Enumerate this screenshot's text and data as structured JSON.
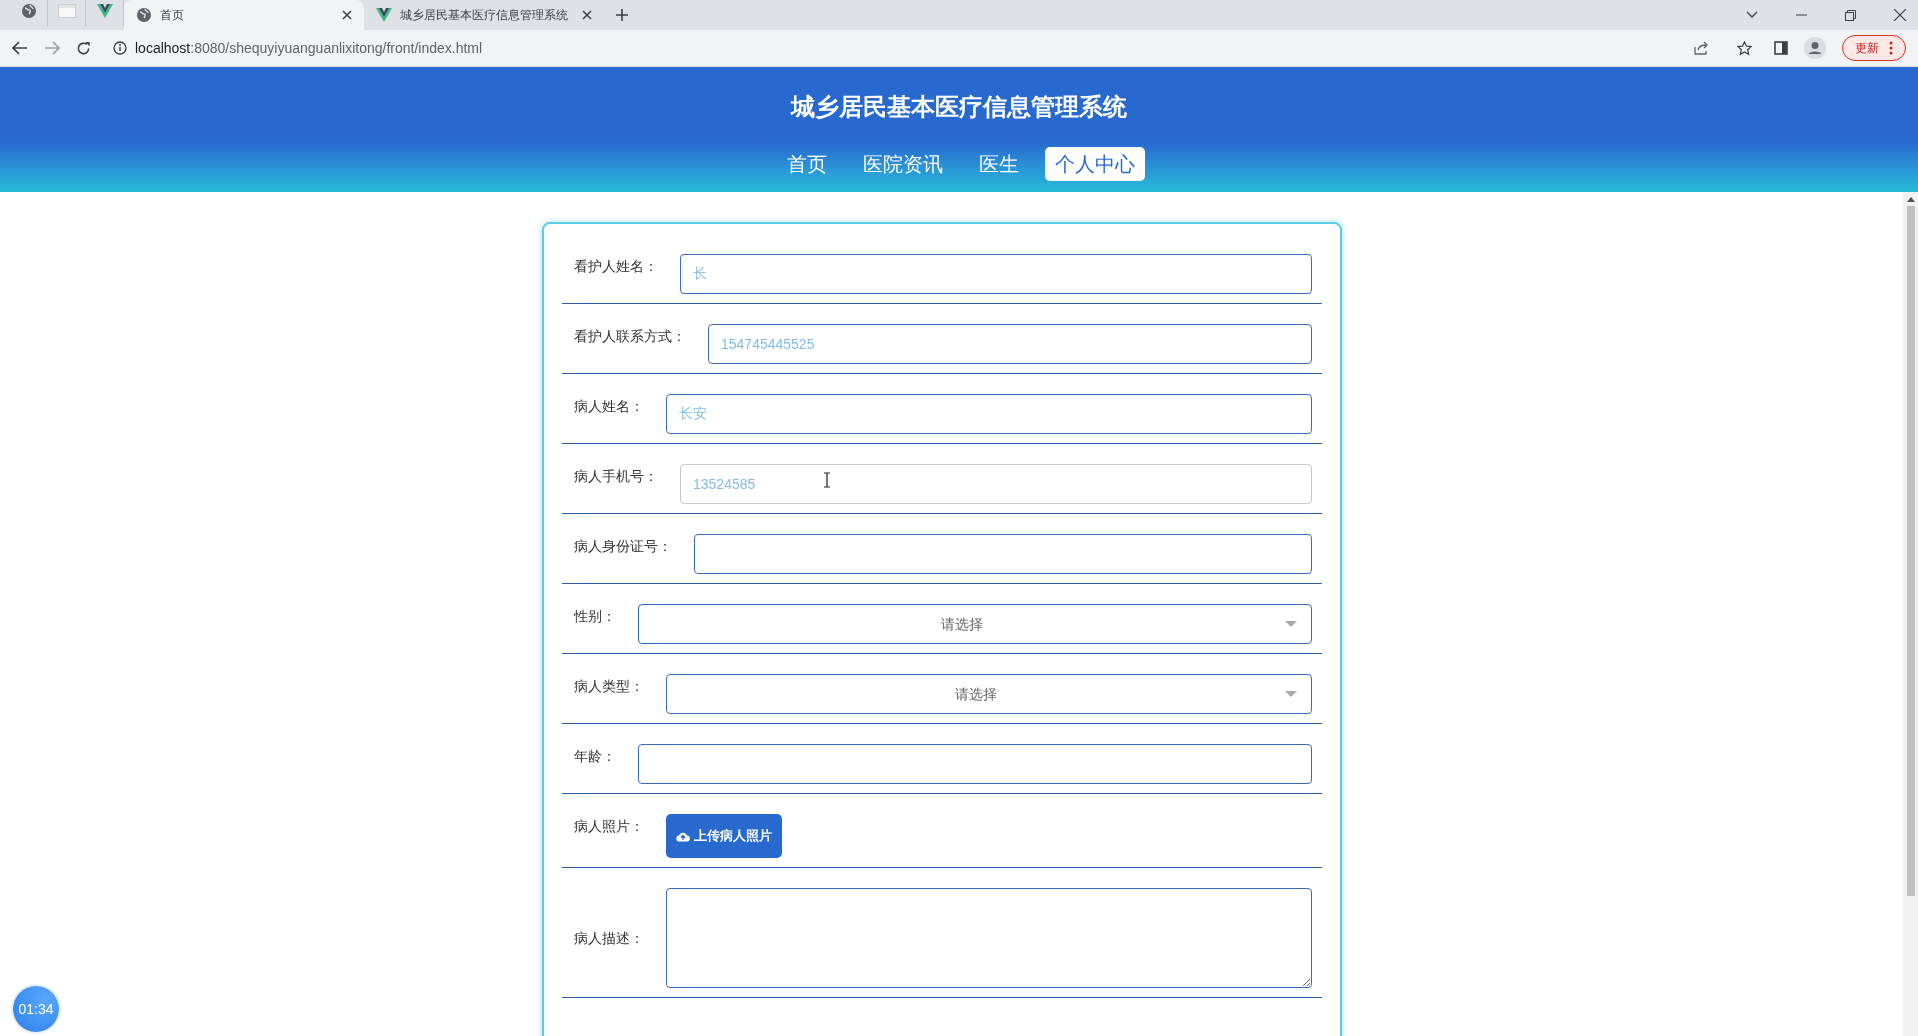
{
  "browser": {
    "tabs": [
      {
        "kind": "pinned",
        "selected": false
      },
      {
        "kind": "pinned",
        "selected": false
      },
      {
        "kind": "pinned",
        "selected": false
      },
      {
        "kind": "tab",
        "title": "首页",
        "selected": true
      },
      {
        "kind": "tab",
        "title": "城乡居民基本医疗信息管理系统",
        "selected": false
      }
    ],
    "url_host": "localhost",
    "url_rest": ":8080/shequyiyuanguanlixitong/front/index.html",
    "update_button": "更新"
  },
  "header": {
    "title": "城乡居民基本医疗信息管理系统",
    "nav": [
      {
        "label": "首页",
        "selected": false
      },
      {
        "label": "医院资讯",
        "selected": false
      },
      {
        "label": "医生",
        "selected": false
      },
      {
        "label": "个人中心",
        "selected": true
      }
    ]
  },
  "form": {
    "fields": [
      {
        "kind": "text",
        "label": "看护人姓名：",
        "value": "长",
        "focused": false
      },
      {
        "kind": "text",
        "label": "看护人联系方式：",
        "value": "154745445525",
        "focused": false
      },
      {
        "kind": "text",
        "label": "病人姓名：",
        "value": "长安",
        "focused": false
      },
      {
        "kind": "text",
        "label": "病人手机号：",
        "value": "13524585",
        "focused": true
      },
      {
        "kind": "text",
        "label": "病人身份证号：",
        "focused": false
      },
      {
        "kind": "select",
        "label": "性别：",
        "placeholder": "请选择"
      },
      {
        "kind": "select",
        "label": "病人类型：",
        "placeholder": "请选择"
      },
      {
        "kind": "text",
        "label": "年龄：",
        "focused": false
      },
      {
        "kind": "upload",
        "label": "病人照片：",
        "button": "上传病人照片"
      },
      {
        "kind": "textarea",
        "label": "病人描述："
      }
    ]
  },
  "timer": "01:34"
}
